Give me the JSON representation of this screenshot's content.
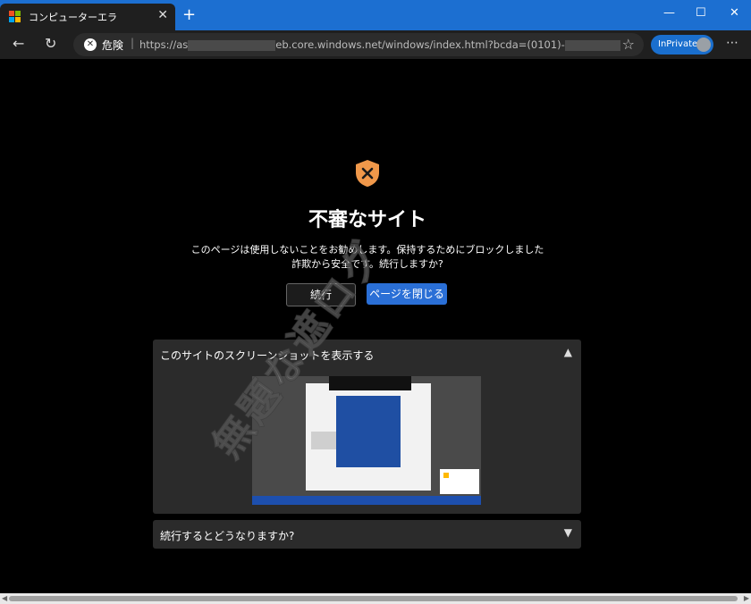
{
  "tab": {
    "title": "コンピューターエラ",
    "close": "✕",
    "new_tab": "+"
  },
  "window_controls": {
    "minimize": "—",
    "maximize": "☐",
    "close": "✕"
  },
  "toolbar": {
    "back": "←",
    "refresh": "↻",
    "security_label": "危険",
    "separator": "|",
    "url_part1": "https://as",
    "url_blur1": "xxxxxxxxxxxxxxxxx",
    "url_part2": "eb.core.windows.net/windows/index.html?bcda=(0101)-",
    "url_blur2": "xxxxxxxxxx",
    "favorite_icon": "star-outline-icon",
    "inprivate_label": "InPrivate",
    "menu": "⋯"
  },
  "warning": {
    "icon": "shield-x-icon",
    "icon_color": "#f0984a",
    "title": "不審なサイト",
    "line1": "このページは使用しないことをお勧めします。保持するためにブロックしました",
    "line2": "詐欺から安全です。続行しますか?",
    "continue_label": "続行",
    "close_page_label": "ページを閉じる"
  },
  "panels": {
    "screenshot_title": "このサイトのスクリーンショットを表示する",
    "consequence_title": "続行するとどうなりますか?"
  },
  "watermark": "無題な遮ログ",
  "accent_color": "#2a6fd6"
}
